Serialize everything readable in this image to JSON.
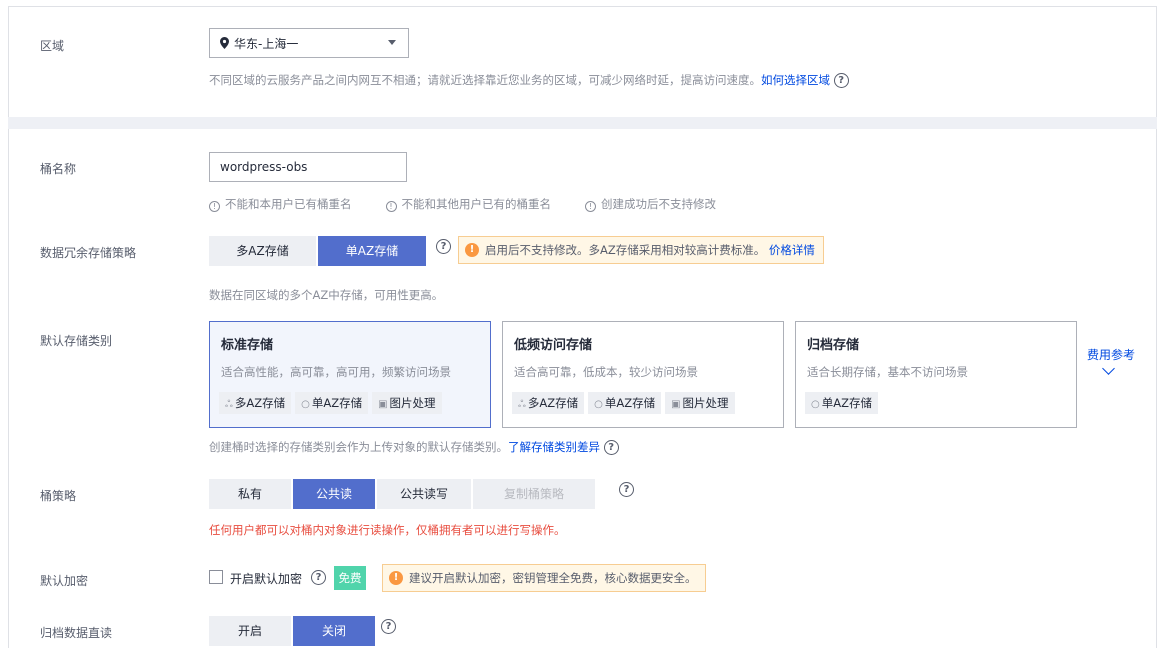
{
  "region": {
    "label": "区域",
    "selected": "华东-上海一",
    "hint": "不同区域的云服务产品之间内网互不相通；请就近选择靠近您业务的区域，可减少网络时延，提高访问速度。",
    "hint_link": "如何选择区域"
  },
  "bucket_name": {
    "label": "桶名称",
    "value": "wordpress-obs",
    "rules": [
      "不能和本用户已有桶重名",
      "不能和其他用户已有的桶重名",
      "创建成功后不支持修改"
    ]
  },
  "redundancy": {
    "label": "数据冗余存储策略",
    "options": [
      "多AZ存储",
      "单AZ存储"
    ],
    "selected": "单AZ存储",
    "warning": "启用后不支持修改。多AZ存储采用相对较高计费标准。",
    "warning_link": "价格详情",
    "hint": "数据在同区域的多个AZ中存储，可用性更高。"
  },
  "storage_class": {
    "label": "默认存储类别",
    "cards": [
      {
        "title": "标准存储",
        "desc": "适合高性能，高可靠，高可用，频繁访问场景",
        "tags": [
          "多AZ存储",
          "单AZ存储",
          "图片处理"
        ]
      },
      {
        "title": "低频访问存储",
        "desc": "适合高可靠，低成本，较少访问场景",
        "tags": [
          "多AZ存储",
          "单AZ存储",
          "图片处理"
        ]
      },
      {
        "title": "归档存储",
        "desc": "适合长期存储，基本不访问场景",
        "tags": [
          "单AZ存储"
        ]
      }
    ],
    "fee_link": "费用参考",
    "hint": "创建桶时选择的存储类别会作为上传对象的默认存储类别。",
    "hint_link": "了解存储类别差异"
  },
  "bucket_policy": {
    "label": "桶策略",
    "options": [
      "私有",
      "公共读",
      "公共读写",
      "复制桶策略"
    ],
    "selected": "公共读",
    "warning": "任何用户都可以对桶内对象进行读操作，仅桶拥有者可以进行写操作。"
  },
  "encryption": {
    "label": "默认加密",
    "checkbox_label": "开启默认加密",
    "badge": "免费",
    "warning": "建议开启默认加密，密钥管理全免费，核心数据更安全。"
  },
  "archive_read": {
    "label": "归档数据直读",
    "options": [
      "开启",
      "关闭"
    ],
    "selected": "关闭"
  },
  "colors": {
    "primary": "#526ecc",
    "link": "#0049e0",
    "warning_bg": "#fff7e6",
    "danger_text": "#e84e40",
    "free_badge": "#50d4ab"
  }
}
